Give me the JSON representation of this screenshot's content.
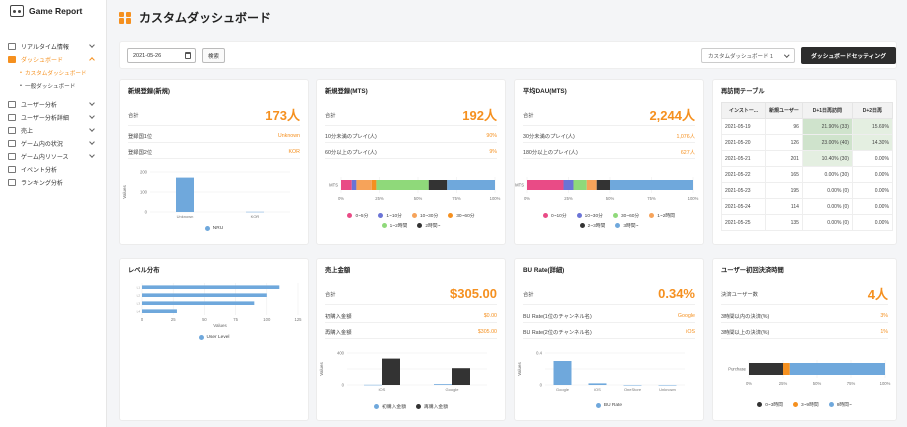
{
  "app": {
    "name": "Game Report"
  },
  "sidebar": {
    "items": [
      {
        "label": "リアルタイム情報"
      },
      {
        "label": "ダッシュボード"
      },
      {
        "label": "ユーザー分析"
      },
      {
        "label": "ユーザー分析詳細"
      },
      {
        "label": "売上"
      },
      {
        "label": "ゲーム内の状況"
      },
      {
        "label": "ゲーム内リソース"
      },
      {
        "label": "イベント分析"
      },
      {
        "label": "ランキング分析"
      }
    ],
    "subitems": [
      {
        "label": "カスタムダッシュボード"
      },
      {
        "label": "一般ダッシュボード"
      }
    ]
  },
  "header": {
    "title": "カスタムダッシュボード"
  },
  "toolbar": {
    "date": "2021-05-26",
    "search_label": "検索",
    "dashboard_select": "カスタムダッシュボード 1",
    "setting_label": "ダッシュボードセッティング"
  },
  "colors": {
    "accent": "#f5901f",
    "blue": "#6fa8dc",
    "dark": "#333333"
  },
  "cards": {
    "new_reg_platform": {
      "title": "新規登録(新規)",
      "total_label": "合計",
      "total_value": "173人",
      "rows": [
        {
          "label": "登録国1位",
          "value": "Unknown"
        },
        {
          "label": "登録国2位",
          "value": "KOR"
        }
      ]
    },
    "new_reg_mts": {
      "title": "新規登録(MTS)",
      "total_label": "合計",
      "total_value": "192人",
      "rows": [
        {
          "label": "10分未満のプレイ(人)",
          "value": "90%"
        },
        {
          "label": "60分以上のプレイ(人)",
          "value": "9%"
        }
      ]
    },
    "dau_mts": {
      "title": "平均DAU(MTS)",
      "total_label": "合計",
      "total_value": "2,244人",
      "rows": [
        {
          "label": "30分未満のプレイ(人)",
          "value": "1,076人"
        },
        {
          "label": "180分以上のプレイ(人)",
          "value": "627人"
        }
      ]
    },
    "retention": {
      "title": "再訪問テーブル",
      "columns": [
        "インストー...",
        "新規ユーザー",
        "D+1日再訪問",
        "D+2日再"
      ],
      "rows": [
        [
          "2021-05-19",
          "96",
          "21.90% (33)",
          "15.69%"
        ],
        [
          "2021-05-20",
          "126",
          "23.00% (40)",
          "14.30%"
        ],
        [
          "2021-05-21",
          "201",
          "10.40% (30)",
          "0.00%"
        ],
        [
          "2021-05-22",
          "165",
          "0.00% (30)",
          "0.00%"
        ],
        [
          "2021-05-23",
          "195",
          "0.00% (0)",
          "0.00%"
        ],
        [
          "2021-05-24",
          "114",
          "0.00% (0)",
          "0.00%"
        ],
        [
          "2021-05-25",
          "135",
          "0.00% (0)",
          "0.00%"
        ]
      ]
    },
    "level": {
      "title": "レベル分布"
    },
    "sales": {
      "title": "売上金額",
      "total_label": "合計",
      "total_value": "$305.00",
      "rows": [
        {
          "label": "初購入金額",
          "value": "$0.00"
        },
        {
          "label": "再購入金額",
          "value": "$305.00"
        }
      ]
    },
    "bu_rate": {
      "title": "BU Rate(詳細)",
      "total_label": "合計",
      "total_value": "0.34%",
      "rows": [
        {
          "label": "BU Rate(1位のチャンネル名)",
          "value": "Google"
        },
        {
          "label": "BU Rate(2位のチャンネル名)",
          "value": "iOS"
        }
      ]
    },
    "purchase_time": {
      "title": "ユーザー初回決済時間",
      "total_label": "決済ユーザー数",
      "total_value": "4人",
      "rows": [
        {
          "label": "3時間以内の決済(%)",
          "value": "3%"
        },
        {
          "label": "3時間以上の決済(%)",
          "value": "1%"
        }
      ]
    }
  },
  "chart_data": [
    {
      "type": "bar",
      "id": "new_reg_platform",
      "categories": [
        "Unknown",
        "KOR"
      ],
      "series": [
        {
          "name": "NRU",
          "values": [
            172,
            1
          ],
          "color": "#6fa8dc"
        }
      ],
      "ylabel": "Values",
      "ylim": [
        0,
        200
      ],
      "yticks": [
        "200",
        "100",
        "0"
      ],
      "legend": "bottom"
    },
    {
      "type": "bar",
      "id": "new_reg_mts",
      "orientation": "horizontal-stacked",
      "category": "MTS",
      "series": [
        {
          "name": "0~5分",
          "value": 7,
          "color": "#e94b86"
        },
        {
          "name": "1~10分",
          "value": 3,
          "color": "#6b74d6"
        },
        {
          "name": "10~30分",
          "value": 10,
          "color": "#f6a35a"
        },
        {
          "name": "30~60分",
          "value": 3,
          "color": "#f5901f"
        },
        {
          "name": "1~2時間",
          "value": 34,
          "color": "#8fd97a"
        },
        {
          "name": "2時間~",
          "value": 12,
          "color": "#333333"
        },
        {
          "name": "",
          "value": 31,
          "color": "#6fa8dc"
        }
      ],
      "xticks": [
        "0%",
        "25%",
        "50%",
        "75%",
        "100%"
      ],
      "legend": "bottom"
    },
    {
      "type": "bar",
      "id": "dau_mts",
      "orientation": "horizontal-stacked",
      "category": "MTS",
      "series": [
        {
          "name": "0~10分",
          "value": 22,
          "color": "#e94b86"
        },
        {
          "name": "10~30分",
          "value": 6,
          "color": "#6b74d6"
        },
        {
          "name": "30~60分",
          "value": 8,
          "color": "#8fd97a"
        },
        {
          "name": "1~2時間",
          "value": 6,
          "color": "#f6a35a"
        },
        {
          "name": "2~3時間",
          "value": 8,
          "color": "#333333"
        },
        {
          "name": "3時間~",
          "value": 50,
          "color": "#6fa8dc"
        }
      ],
      "xticks": [
        "0%",
        "25%",
        "50%",
        "75%",
        "100%"
      ],
      "legend": "bottom"
    },
    {
      "type": "bar",
      "id": "level",
      "orientation": "horizontal",
      "categories": [
        "L1",
        "L2",
        "L3",
        "L4"
      ],
      "series": [
        {
          "name": "User Level",
          "values": [
            110,
            100,
            90,
            28
          ],
          "color": "#6fa8dc"
        }
      ],
      "xlabel": "Values",
      "xlim": [
        0,
        125
      ],
      "xticks": [
        "0",
        "25",
        "50",
        "75",
        "100",
        "125"
      ],
      "legend": "bottom"
    },
    {
      "type": "bar",
      "id": "sales",
      "categories": [
        "iOS",
        "Google"
      ],
      "series": [
        {
          "name": "初購入金額",
          "values": [
            2,
            10
          ],
          "color": "#6fa8dc"
        },
        {
          "name": "再購入金額",
          "values": [
            330,
            210
          ],
          "color": "#333333"
        }
      ],
      "ylabel": "Values",
      "ylim": [
        0,
        400
      ],
      "yticks": [
        "400",
        "",
        "0"
      ],
      "legend": "bottom"
    },
    {
      "type": "bar",
      "id": "bu_rate",
      "categories": [
        "Google",
        "iOS",
        "OneStore",
        "Unknown"
      ],
      "series": [
        {
          "name": "BU Rate",
          "values": [
            0.3,
            0.02,
            0,
            0
          ],
          "color": "#6fa8dc"
        }
      ],
      "ylabel": "Values",
      "ylim": [
        0,
        0.4
      ],
      "yticks": [
        "0.4",
        "",
        "0"
      ],
      "legend": "bottom"
    },
    {
      "type": "bar",
      "id": "purchase_time",
      "orientation": "horizontal-stacked",
      "category": "Purchase",
      "series": [
        {
          "name": "0~3時間",
          "value": 25,
          "color": "#333333"
        },
        {
          "name": "3~9時間",
          "value": 5,
          "color": "#f5901f"
        },
        {
          "name": "9時間~",
          "value": 70,
          "color": "#6fa8dc"
        }
      ],
      "xticks": [
        "0%",
        "25%",
        "50%",
        "75%",
        "100%"
      ],
      "legend": "bottom"
    }
  ]
}
